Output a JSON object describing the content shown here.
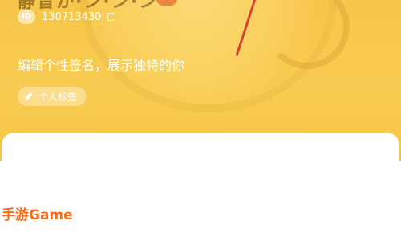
{
  "profile": {
    "username": "静音か·ン·ン·ン",
    "id_label": "ID",
    "id_value": "130713430",
    "signature": "编辑个性签名，展示独特的你",
    "tag_label": "个人标签"
  },
  "watermark": {
    "text": "手游Game"
  },
  "colors": {
    "header_bg": "#f8cc52",
    "watermark": "#ff6a10",
    "needle": "#d6452b"
  }
}
